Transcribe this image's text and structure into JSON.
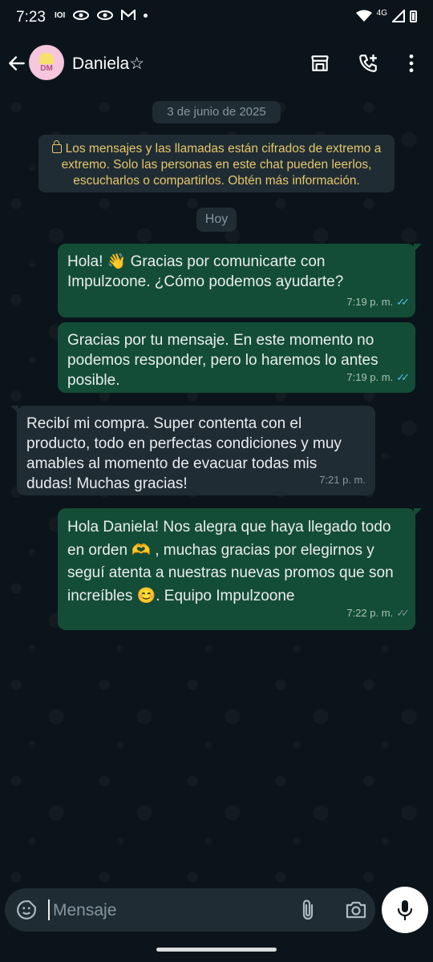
{
  "status_bar": {
    "time": "7:23",
    "icons": [
      "ioi-icon",
      "eye-icon",
      "eye-icon",
      "gmail-icon",
      "dot"
    ],
    "network": "4G"
  },
  "header": {
    "contact_name": "Daniela☆",
    "avatar_text": "DM"
  },
  "chat": {
    "date_chip": "3 de junio de 2025",
    "encryption_notice": "Los mensajes y las llamadas están cifrados de extremo a extremo. Solo las personas en este chat pueden leerlos, escucharlos o compartirlos. Obtén más información.",
    "today_chip": "Hoy",
    "messages": [
      {
        "direction": "outgoing",
        "text": "Hola! 👋 Gracias por comunicarte con Impulzoone. ¿Cómo podemos ayudarte?",
        "time": "7:19 p. m.",
        "status": "read"
      },
      {
        "direction": "outgoing",
        "text": "Gracias por tu mensaje. En este momento no podemos responder, pero lo haremos lo antes posible.",
        "time": "7:19 p. m.",
        "status": "read"
      },
      {
        "direction": "incoming",
        "text": "Recibí mi compra. Super contenta con el producto, todo en perfectas condiciones y muy amables al momento de evacuar todas mis dudas! Muchas gracias!",
        "time": "7:21 p. m."
      },
      {
        "direction": "outgoing",
        "text": "Hola Daniela! Nos alegra que haya llegado todo en orden 🫶 , muchas gracias por elegirnos y seguí atenta a nuestras nuevas promos que son increíbles 😊. Equipo Impulzoone",
        "time": "7:22 p. m.",
        "status": "delivered"
      }
    ]
  },
  "composer": {
    "placeholder": "Mensaje"
  },
  "colors": {
    "background": "#0b141a",
    "outgoing_bubble": "#144d37",
    "incoming_bubble": "#202c33",
    "read_tick": "#53bdeb",
    "notice_text": "#e6c76a"
  }
}
